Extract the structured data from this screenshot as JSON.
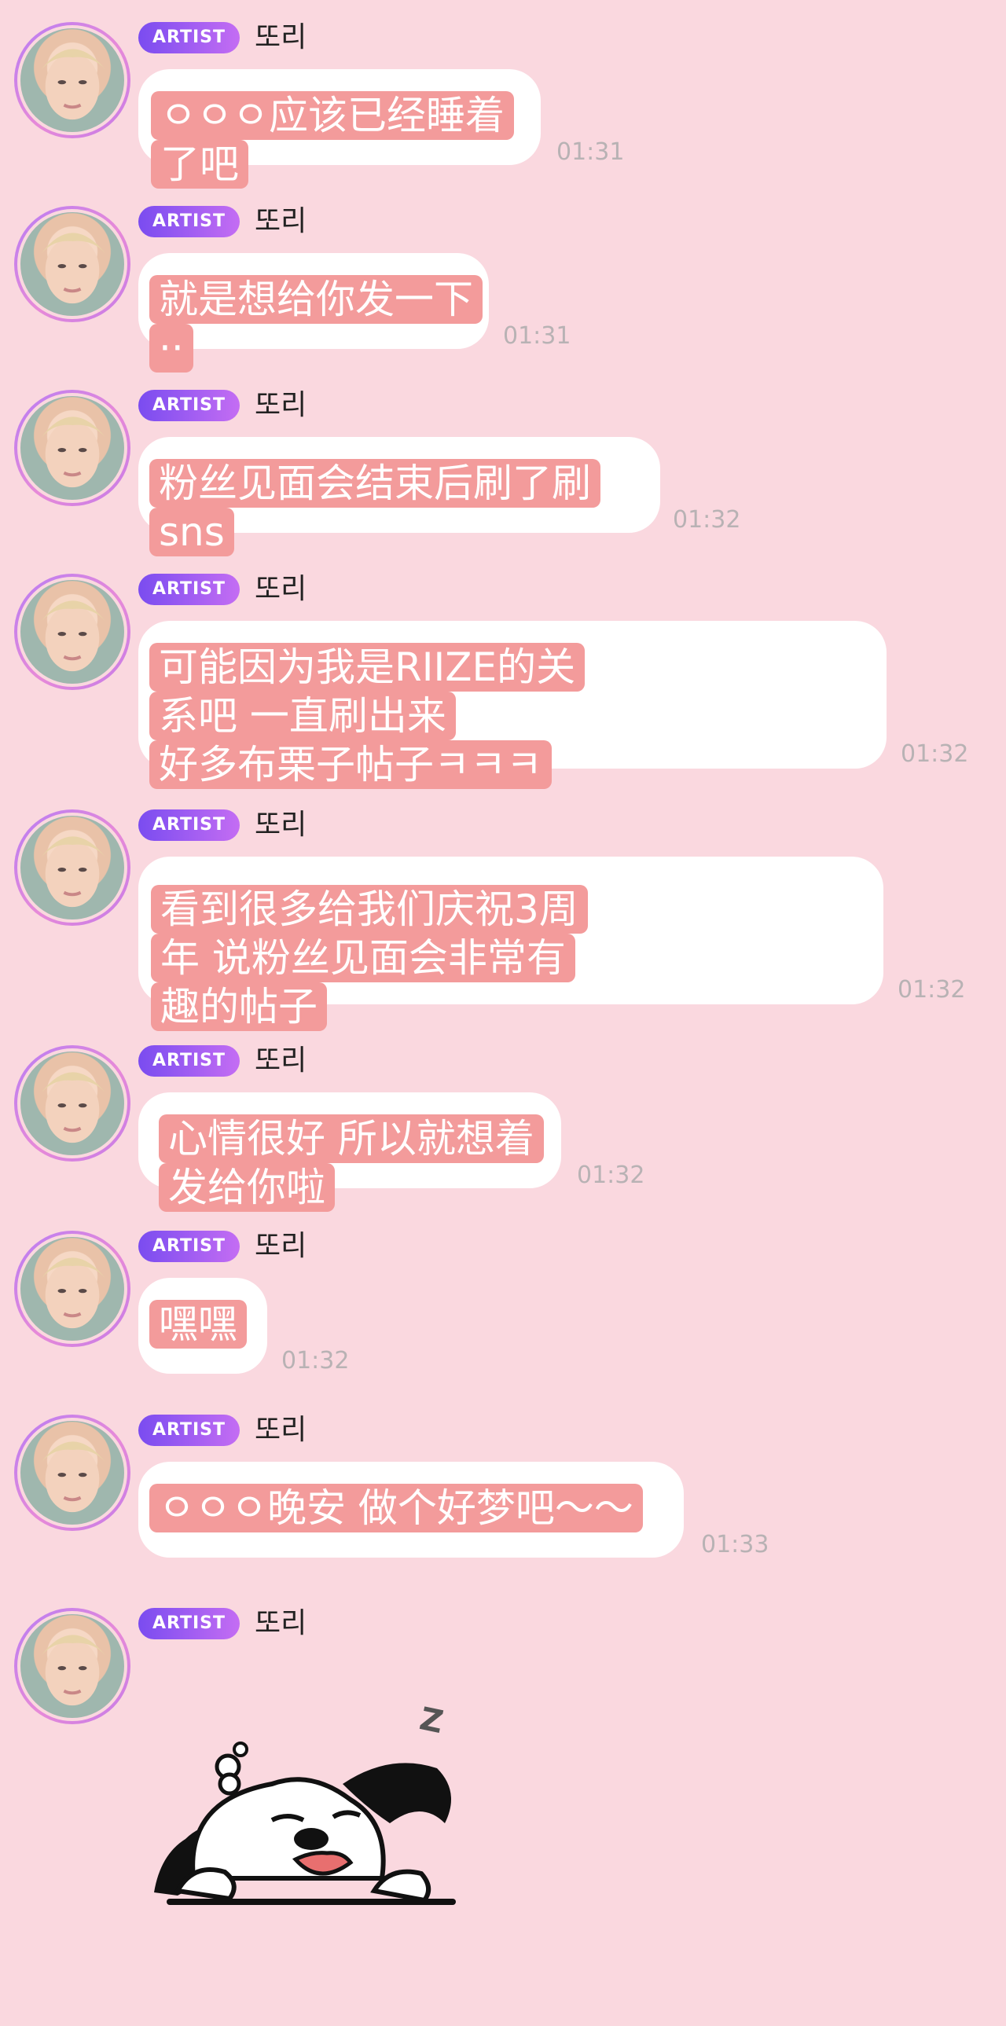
{
  "sender": {
    "badge": "ARTIST",
    "name": "또리"
  },
  "messages": [
    {
      "text": "ㅇㅇㅇ应该已经睡着了吧",
      "time": "01:31"
    },
    {
      "text": "就是想给你发一下··",
      "time": "01:31"
    },
    {
      "text": "粉丝见面会结束后刷了刷sns",
      "time": "01:32"
    },
    {
      "text": "可能因为我是RIIZE的关系吧 一直刷出来好多布栗子帖子ㅋㅋㅋ",
      "time": "01:32"
    },
    {
      "text": "看到很多给我们庆祝3周年 说粉丝见面会非常有趣的帖子",
      "time": "01:32"
    },
    {
      "text": "心情很好 所以就想着发给你啦",
      "time": "01:32"
    },
    {
      "text": "嘿嘿",
      "time": "01:32"
    },
    {
      "text": "ㅇㅇㅇ晚安 做个好梦吧～～",
      "time": "01:33"
    }
  ],
  "sticker": {
    "name": "sleeping-puppy-sticker",
    "zz_glyph": "Z"
  }
}
